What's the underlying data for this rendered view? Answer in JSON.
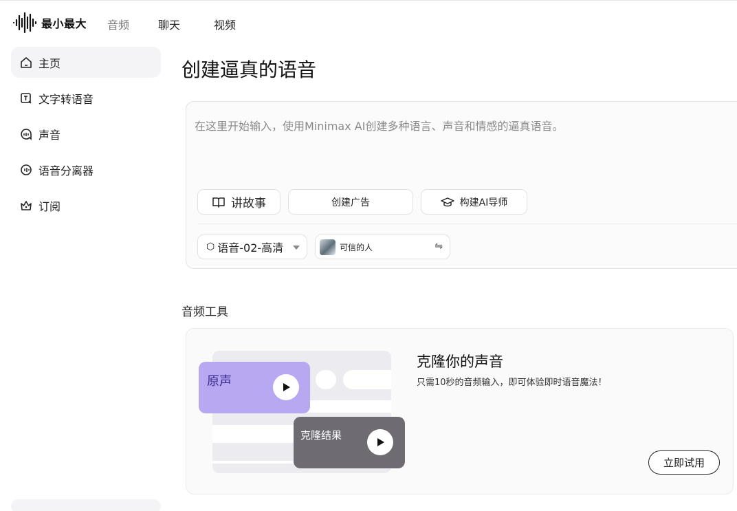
{
  "app": {
    "logo_text": "最小最大"
  },
  "nav": {
    "audio": "音频",
    "chat": "聊天",
    "video": "视频"
  },
  "sidebar": {
    "items": [
      {
        "label": "主页",
        "icon": "home-icon"
      },
      {
        "label": "文字转语音",
        "icon": "text-to-speech-icon"
      },
      {
        "label": "声音",
        "icon": "voice-icon"
      },
      {
        "label": "语音分离器",
        "icon": "voice-isolator-icon"
      },
      {
        "label": "订阅",
        "icon": "crown-icon"
      }
    ]
  },
  "main": {
    "title": "创建逼真的语音",
    "editor": {
      "placeholder": "在这里开始输入，使用Minimax AI创建多种语言、声音和情感的逼真语音。",
      "chips": [
        {
          "label": "讲故事",
          "icon": "book-icon"
        },
        {
          "label": "创建广告",
          "icon": ""
        },
        {
          "label": "构建AI导师",
          "icon": "graduation-cap-icon"
        }
      ],
      "model": "语音-02-高清",
      "voice": "可信的人",
      "swap_icon": "⇋"
    },
    "tools_title": "音频工具",
    "tool_card": {
      "original_label": "原声",
      "result_label": "克隆结果",
      "title": "克隆你的声音",
      "description": "只需10秒的音频输入，即可体验即时语音魔法！",
      "button": "立即试用"
    }
  },
  "colors": {
    "accent_purple": "#b8a8f2",
    "result_gray": "#6e6c72"
  }
}
